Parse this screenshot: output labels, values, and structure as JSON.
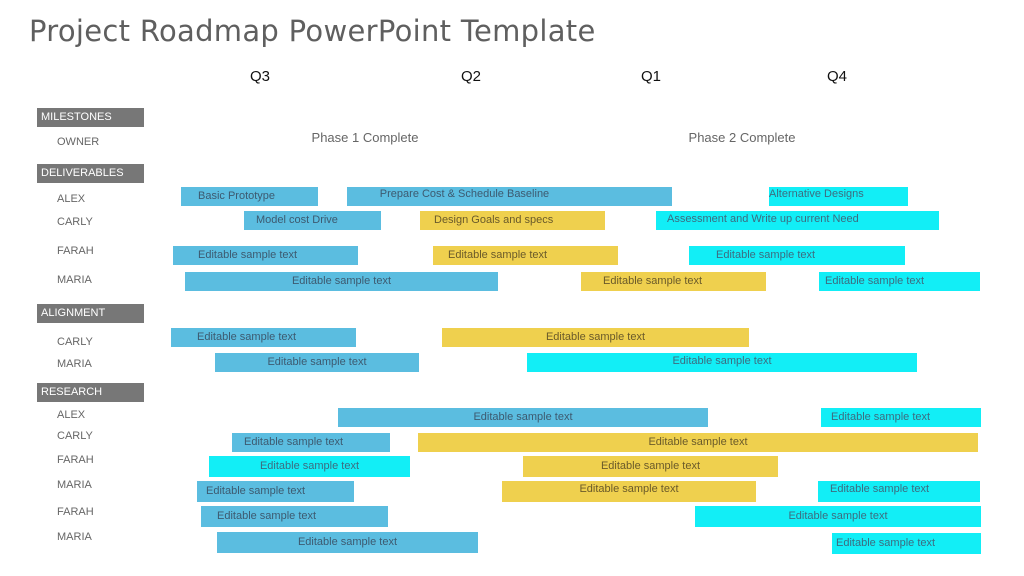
{
  "title": "Project Roadmap PowerPoint Template",
  "quarters": [
    "Q3",
    "Q2",
    "Q1",
    "Q4"
  ],
  "phases": [
    "Phase 1 Complete",
    "Phase 2 Complete"
  ],
  "colors": {
    "blue": "#5bbde0",
    "yellow": "#efd04e",
    "cyan": "#12eef6",
    "section": "#777777"
  },
  "sections": [
    {
      "label": "MILESTONES",
      "owners": [
        "OWNER"
      ]
    },
    {
      "label": "DELIVERABLES",
      "owners": [
        "ALEX",
        "CARLY",
        "FARAH",
        "MARIA"
      ]
    },
    {
      "label": "ALIGNMENT",
      "owners": [
        "CARLY",
        "MARIA"
      ]
    },
    {
      "label": "RESEARCH",
      "owners": [
        "ALEX",
        "CARLY",
        "FARAH",
        "MARIA",
        "FARAH",
        "MARIA"
      ]
    }
  ],
  "bars": [
    {
      "owner": "ALEX",
      "text": "Basic Prototype",
      "color": "blue"
    },
    {
      "owner": "ALEX",
      "text": "Prepare Cost & Schedule Baseline",
      "color": "blue"
    },
    {
      "owner": "ALEX",
      "text": "Alternative Designs",
      "color": "cyan"
    },
    {
      "owner": "CARLY",
      "text": "Model  cost Drive",
      "color": "blue"
    },
    {
      "owner": "CARLY",
      "text": "Design Goals and specs",
      "color": "yellow"
    },
    {
      "owner": "CARLY",
      "text": "Assessment and Write up current Need",
      "color": "cyan"
    },
    {
      "owner": "FARAH",
      "text": "Editable sample text",
      "color": "blue"
    },
    {
      "owner": "FARAH",
      "text": "Editable sample text",
      "color": "yellow"
    },
    {
      "owner": "FARAH",
      "text": "Editable sample text",
      "color": "cyan"
    },
    {
      "owner": "MARIA",
      "text": "Editable sample text",
      "color": "blue"
    },
    {
      "owner": "MARIA",
      "text": "Editable sample text",
      "color": "yellow"
    },
    {
      "owner": "MARIA",
      "text": "Editable sample text",
      "color": "cyan"
    },
    {
      "owner": "CARLY",
      "text": "Editable sample text",
      "color": "blue"
    },
    {
      "owner": "CARLY",
      "text": "Editable sample text",
      "color": "yellow"
    },
    {
      "owner": "MARIA",
      "text": "Editable sample text",
      "color": "blue"
    },
    {
      "owner": "MARIA",
      "text": "Editable sample text",
      "color": "cyan"
    },
    {
      "owner": "ALEX",
      "text": "Editable sample text",
      "color": "blue"
    },
    {
      "owner": "ALEX",
      "text": "Editable sample text",
      "color": "cyan"
    },
    {
      "owner": "CARLY",
      "text": "Editable sample text",
      "color": "blue"
    },
    {
      "owner": "CARLY",
      "text": "Editable sample text",
      "color": "yellow"
    },
    {
      "owner": "FARAH",
      "text": "Editable sample text",
      "color": "cyan"
    },
    {
      "owner": "FARAH",
      "text": "Editable sample text",
      "color": "yellow"
    },
    {
      "owner": "MARIA",
      "text": "Editable sample text",
      "color": "blue"
    },
    {
      "owner": "MARIA",
      "text": "Editable sample text",
      "color": "yellow"
    },
    {
      "owner": "MARIA",
      "text": "Editable sample text",
      "color": "cyan"
    },
    {
      "owner": "FARAH",
      "text": "Editable sample text",
      "color": "blue"
    },
    {
      "owner": "FARAH",
      "text": "Editable sample text",
      "color": "cyan"
    },
    {
      "owner": "MARIA",
      "text": "Editable sample text",
      "color": "blue"
    },
    {
      "owner": "MARIA",
      "text": "Editable sample text",
      "color": "cyan"
    }
  ]
}
